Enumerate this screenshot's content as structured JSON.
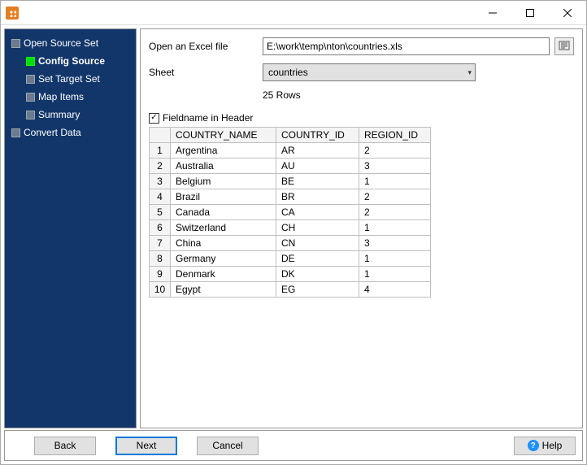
{
  "sidebar": {
    "items": [
      {
        "label": "Open Source Set",
        "sub": false,
        "active": false
      },
      {
        "label": "Config Source",
        "sub": true,
        "active": true
      },
      {
        "label": "Set Target Set",
        "sub": true,
        "active": false
      },
      {
        "label": "Map Items",
        "sub": true,
        "active": false
      },
      {
        "label": "Summary",
        "sub": true,
        "active": false
      },
      {
        "label": "Convert Data",
        "sub": false,
        "active": false
      }
    ]
  },
  "form": {
    "open_label": "Open an Excel file",
    "file_path": "E:\\work\\temp\\nton\\countries.xls",
    "sheet_label": "Sheet",
    "sheet_value": "countries",
    "row_count": "25 Rows",
    "fieldname_label": "Fieldname in Header",
    "fieldname_checked": true
  },
  "table": {
    "columns": [
      "COUNTRY_NAME",
      "COUNTRY_ID",
      "REGION_ID"
    ],
    "rows": [
      [
        "Argentina",
        "AR",
        "2"
      ],
      [
        "Australia",
        "AU",
        "3"
      ],
      [
        "Belgium",
        "BE",
        "1"
      ],
      [
        "Brazil",
        "BR",
        "2"
      ],
      [
        "Canada",
        "CA",
        "2"
      ],
      [
        "Switzerland",
        "CH",
        "1"
      ],
      [
        "China",
        "CN",
        "3"
      ],
      [
        "Germany",
        "DE",
        "1"
      ],
      [
        "Denmark",
        "DK",
        "1"
      ],
      [
        "Egypt",
        "EG",
        "4"
      ]
    ]
  },
  "footer": {
    "back": "Back",
    "next": "Next",
    "cancel": "Cancel",
    "help": "Help"
  }
}
